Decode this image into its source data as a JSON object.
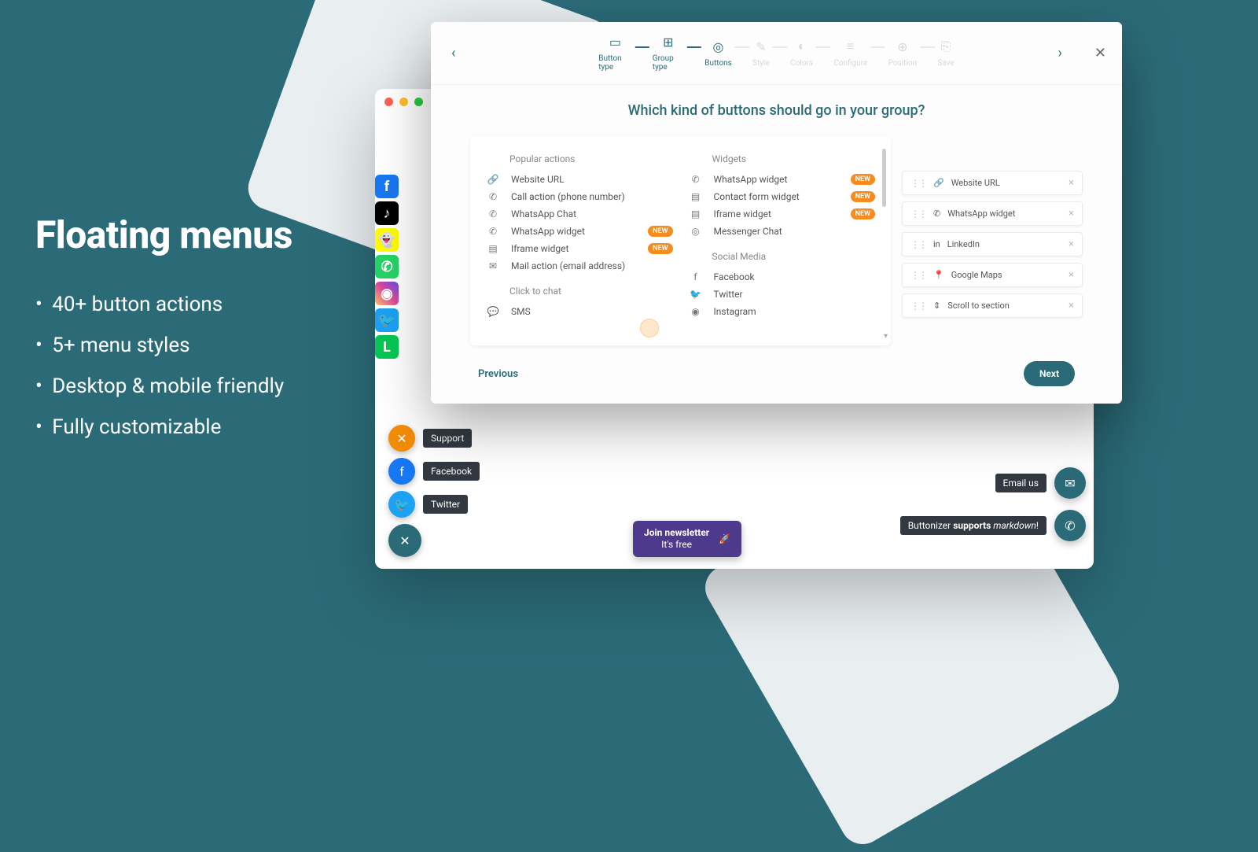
{
  "marketing": {
    "title": "Floating menus",
    "bullets": [
      "40+ button actions",
      "5+ menu styles",
      "Desktop & mobile friendly",
      "Fully customizable"
    ]
  },
  "social_icons": [
    {
      "name": "facebook",
      "bg": "#1877f2",
      "letter": "f"
    },
    {
      "name": "tiktok",
      "bg": "#010101",
      "letter": "♪"
    },
    {
      "name": "snapchat",
      "bg": "#fffc00",
      "letter": "👻"
    },
    {
      "name": "whatsapp",
      "bg": "#25d366",
      "letter": "✆"
    },
    {
      "name": "instagram",
      "bg": "linear-gradient(45deg,#fdc468,#df4996,#5b4fe9)",
      "letter": "◉"
    },
    {
      "name": "twitter",
      "bg": "#1da1f2",
      "letter": "🐦"
    },
    {
      "name": "line",
      "bg": "#06c755",
      "letter": "L"
    }
  ],
  "fab_stack": [
    {
      "bg": "#f48c06",
      "label": "Support",
      "icon": "✕"
    },
    {
      "bg": "#1877f2",
      "label": "Facebook",
      "icon": "f"
    },
    {
      "bg": "#1da1f2",
      "label": "Twitter",
      "icon": "🐦"
    }
  ],
  "fab_main": {
    "bg": "#2b6b78",
    "icon": "✕"
  },
  "newsletter": {
    "line1": "Join newsletter",
    "line2": "It's free"
  },
  "right_fabs": [
    {
      "label": "Email us",
      "icon": "✉"
    },
    {
      "label_html": "Buttonizer <b>supports</b> <em>markdown</em>!",
      "icon": "✆"
    }
  ],
  "modal": {
    "steps": [
      {
        "key": "button-type",
        "label": "Button type",
        "dim": false
      },
      {
        "key": "group-type",
        "label": "Group type",
        "dim": false
      },
      {
        "key": "buttons",
        "label": "Buttons",
        "dim": false
      },
      {
        "key": "style",
        "label": "Style",
        "dim": true
      },
      {
        "key": "colors",
        "label": "Colors",
        "dim": true
      },
      {
        "key": "configure",
        "label": "Configure",
        "dim": true
      },
      {
        "key": "position",
        "label": "Position",
        "dim": true
      },
      {
        "key": "save",
        "label": "Save",
        "dim": true
      }
    ],
    "question": "Which kind of buttons should go in your group?",
    "col1": {
      "h1": "Popular actions",
      "items1": [
        {
          "icon": "🔗",
          "label": "Website URL"
        },
        {
          "icon": "✆",
          "label": "Call action (phone number)"
        },
        {
          "icon": "✆",
          "label": "WhatsApp Chat"
        },
        {
          "icon": "✆",
          "label": "WhatsApp widget",
          "badge": "NEW"
        },
        {
          "icon": "▤",
          "label": "Iframe widget",
          "badge": "NEW"
        },
        {
          "icon": "✉",
          "label": "Mail action (email address)"
        }
      ],
      "h2": "Click to chat",
      "items2": [
        {
          "icon": "💬",
          "label": "SMS"
        }
      ]
    },
    "col2": {
      "h1": "Widgets",
      "items1": [
        {
          "icon": "✆",
          "label": "WhatsApp widget",
          "badge": "NEW"
        },
        {
          "icon": "▤",
          "label": "Contact form widget",
          "badge": "NEW"
        },
        {
          "icon": "▤",
          "label": "Iframe widget",
          "badge": "NEW"
        },
        {
          "icon": "◎",
          "label": "Messenger Chat"
        }
      ],
      "h2": "Social Media",
      "items2": [
        {
          "icon": "f",
          "label": "Facebook"
        },
        {
          "icon": "🐦",
          "label": "Twitter"
        },
        {
          "icon": "◉",
          "label": "Instagram"
        }
      ]
    },
    "selected": [
      {
        "icon": "🔗",
        "label": "Website URL"
      },
      {
        "icon": "✆",
        "label": "WhatsApp widget"
      },
      {
        "icon": "in",
        "label": "LinkedIn"
      },
      {
        "icon": "📍",
        "label": "Google Maps"
      },
      {
        "icon": "⇕",
        "label": "Scroll to section"
      }
    ],
    "prev": "Previous",
    "next": "Next"
  }
}
